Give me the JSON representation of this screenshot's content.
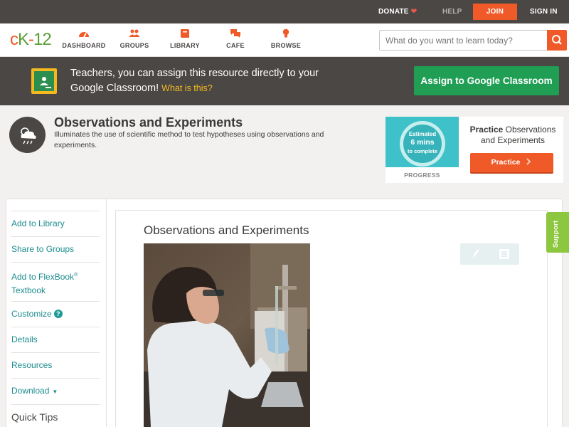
{
  "topbar": {
    "donate": "DONATE",
    "help": "HELP",
    "join": "JOIN",
    "signin": "SIGN IN"
  },
  "logo": {
    "c": "c",
    "k": "K",
    "dash": "-",
    "num": "12"
  },
  "nav": {
    "dashboard": "DASHBOARD",
    "groups": "GROUPS",
    "library": "LIBRARY",
    "cafe": "CAFE",
    "browse": "BROWSE"
  },
  "search": {
    "placeholder": "What do you want to learn today?"
  },
  "classroom_banner": {
    "text": "Teachers, you can assign this resource directly to your Google Classroom!",
    "what_link": "What is this?",
    "assign_button": "Assign to Google Classroom"
  },
  "concept": {
    "title": "Observations and Experiments",
    "description": "Illuminates the use of scientific method to test hypotheses using observations and experiments."
  },
  "practice": {
    "estimated": "Estimated",
    "mins": "6 mins",
    "to_complete": "to complete",
    "progress_label": "PROGRESS",
    "title_bold": "Practice",
    "title_rest": "Observations and Experiments",
    "button": "Practice"
  },
  "sidebar": {
    "add_library": "Add to Library",
    "share_groups": "Share to Groups",
    "add_flexbook": "Add to FlexBook",
    "reg": "®",
    "textbook": "Textbook",
    "customize": "Customize",
    "help_mark": "?",
    "details": "Details",
    "resources": "Resources",
    "download": "Download",
    "download_caret": "▼",
    "quick_tips": "Quick Tips"
  },
  "content": {
    "title": "Observations and Experiments"
  },
  "support_tab": "Support",
  "colors": {
    "brand_orange": "#f05a28",
    "dark_bar": "#4a4745",
    "link_teal": "#1d8c8f",
    "classroom_green": "#1f9e54",
    "support_green": "#8dc63f",
    "practice_teal": "#3fc1c9"
  },
  "icons": {
    "donate": "heart-icon",
    "dashboard": "dashboard-gauge-icon",
    "groups": "people-icon",
    "library": "book-icon",
    "cafe": "chat-bubbles-icon",
    "browse": "lightbulb-icon",
    "search": "search-icon",
    "classroom": "google-classroom-icon",
    "concept": "weather-cloud-icon",
    "practice_arrow": "chevron-right-icon",
    "tool_pen": "pencil-icon",
    "tool_note": "notes-icon"
  }
}
